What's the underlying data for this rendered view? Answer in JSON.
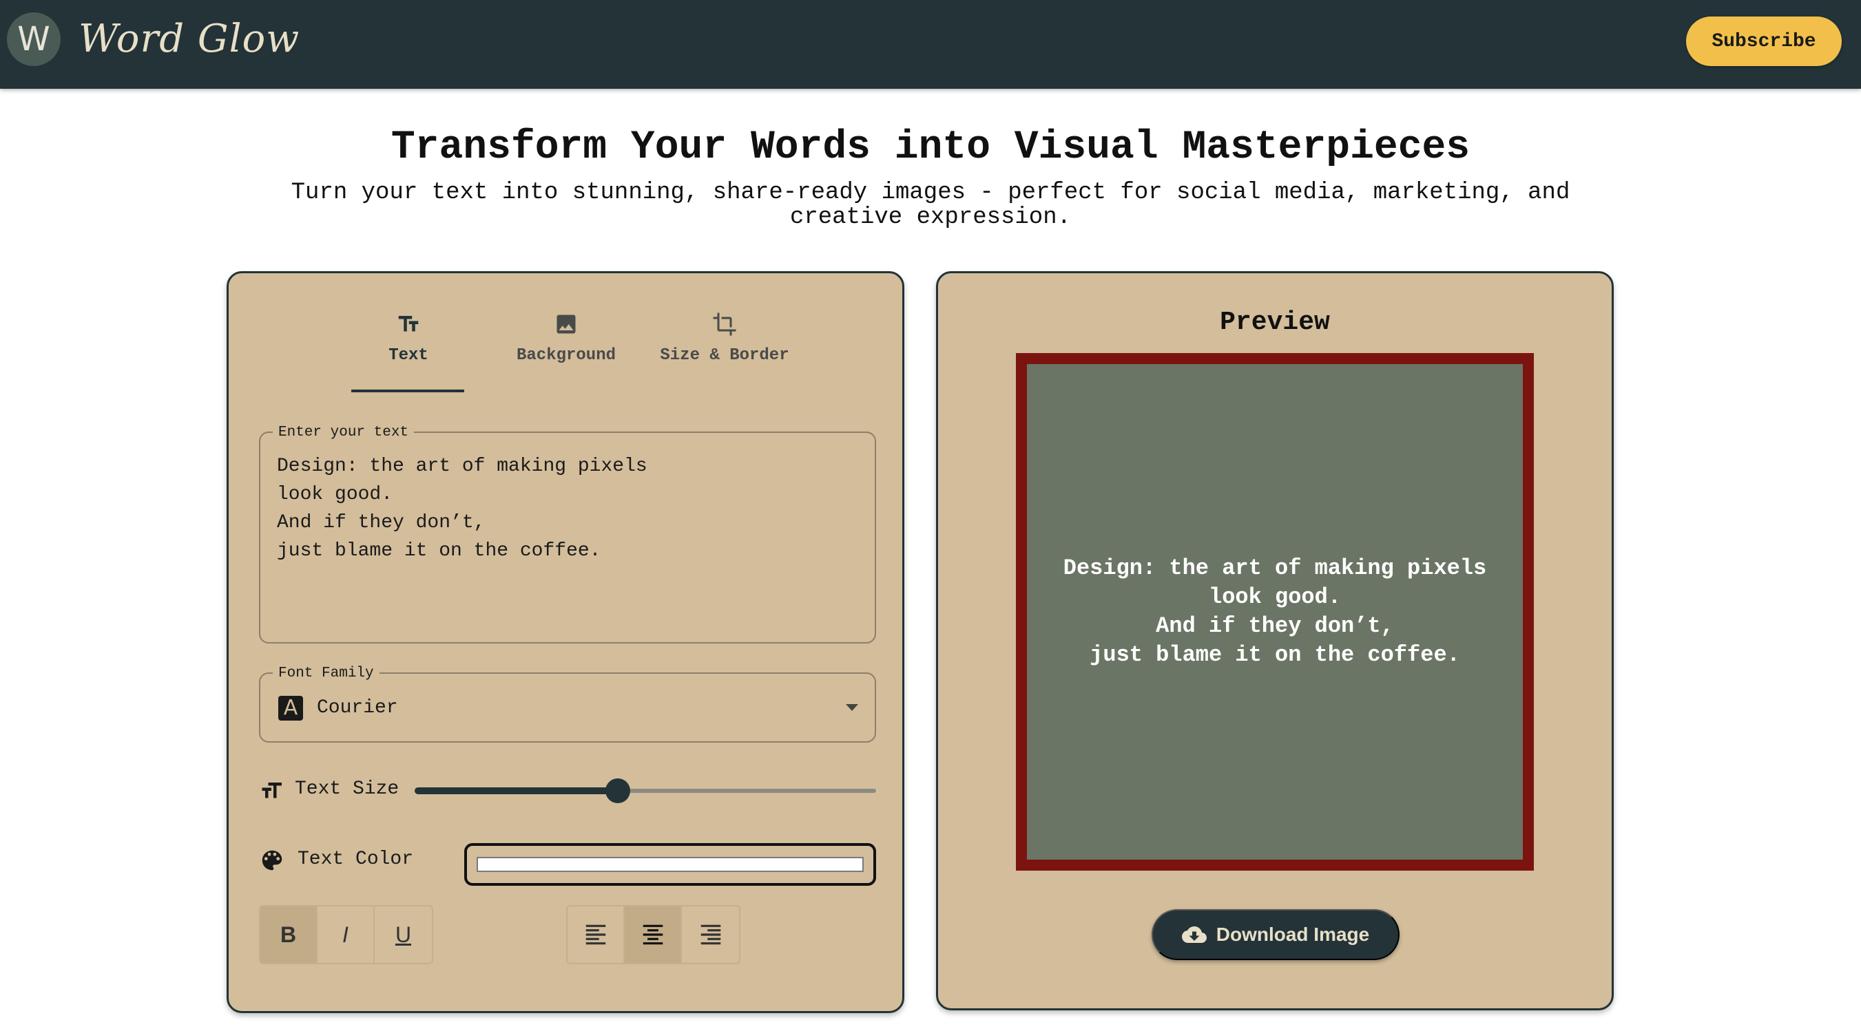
{
  "header": {
    "logo_letter": "W",
    "app_title": "Word Glow",
    "subscribe_label": "Subscribe"
  },
  "hero": {
    "title": "Transform Your Words into Visual Masterpieces",
    "subtitle": "Turn your text into stunning, share-ready images - perfect for social media, marketing, and creative expression."
  },
  "editor": {
    "tabs": [
      {
        "label": "Text",
        "icon": "text-fields-icon",
        "active": true
      },
      {
        "label": "Background",
        "icon": "image-icon",
        "active": false
      },
      {
        "label": "Size & Border",
        "icon": "crop-icon",
        "active": false
      }
    ],
    "text_field": {
      "legend": "Enter your text",
      "value": "Design: the art of making pixels\nlook good.\nAnd if they don’t,\njust blame it on the coffee."
    },
    "font_family": {
      "legend": "Font Family",
      "badge": "A",
      "value": "Courier"
    },
    "text_size": {
      "label": "Text Size",
      "value_fraction": 0.44
    },
    "text_color": {
      "label": "Text Color",
      "value": "#ffffff"
    },
    "format_buttons": [
      {
        "name": "bold",
        "glyph": "B",
        "active": true
      },
      {
        "name": "italic",
        "glyph": "I",
        "active": false
      },
      {
        "name": "underline",
        "glyph": "U",
        "active": false
      }
    ],
    "align_buttons": [
      {
        "name": "left",
        "active": false
      },
      {
        "name": "center",
        "active": true
      },
      {
        "name": "right",
        "active": false
      }
    ]
  },
  "preview": {
    "title": "Preview",
    "text": "Design: the art of making pixels\nlook good.\nAnd if they don’t,\njust blame it on the coffee.",
    "background_color": "#6b7565",
    "border_color": "#7b140f",
    "download_label": "Download Image"
  },
  "colors": {
    "header_bg": "#233338",
    "accent": "#f2c04a",
    "card_bg": "#d3bd9b"
  }
}
